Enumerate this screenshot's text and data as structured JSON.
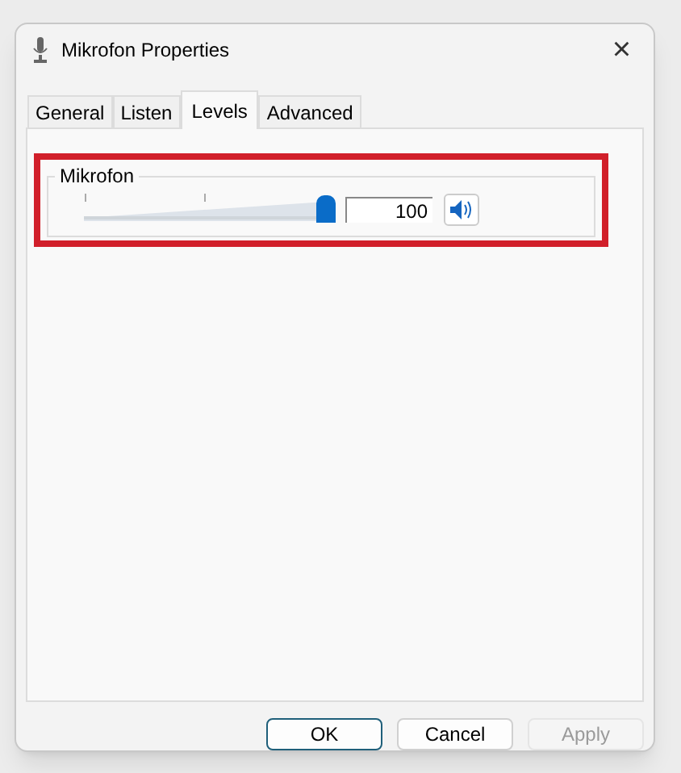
{
  "window": {
    "title": "Mikrofon Properties",
    "close": "×"
  },
  "tabs": [
    {
      "label": "General",
      "selected": false
    },
    {
      "label": "Listen",
      "selected": false
    },
    {
      "label": "Levels",
      "selected": true
    },
    {
      "label": "Advanced",
      "selected": false
    }
  ],
  "levels": {
    "group_label": "Mikrofon",
    "level": 1.0,
    "value": "100",
    "muted": false
  },
  "buttons": [
    {
      "label": "OK",
      "default": true,
      "disabled": false
    },
    {
      "label": "Cancel",
      "default": false,
      "disabled": false
    },
    {
      "label": "Apply",
      "default": false,
      "disabled": true
    }
  ]
}
